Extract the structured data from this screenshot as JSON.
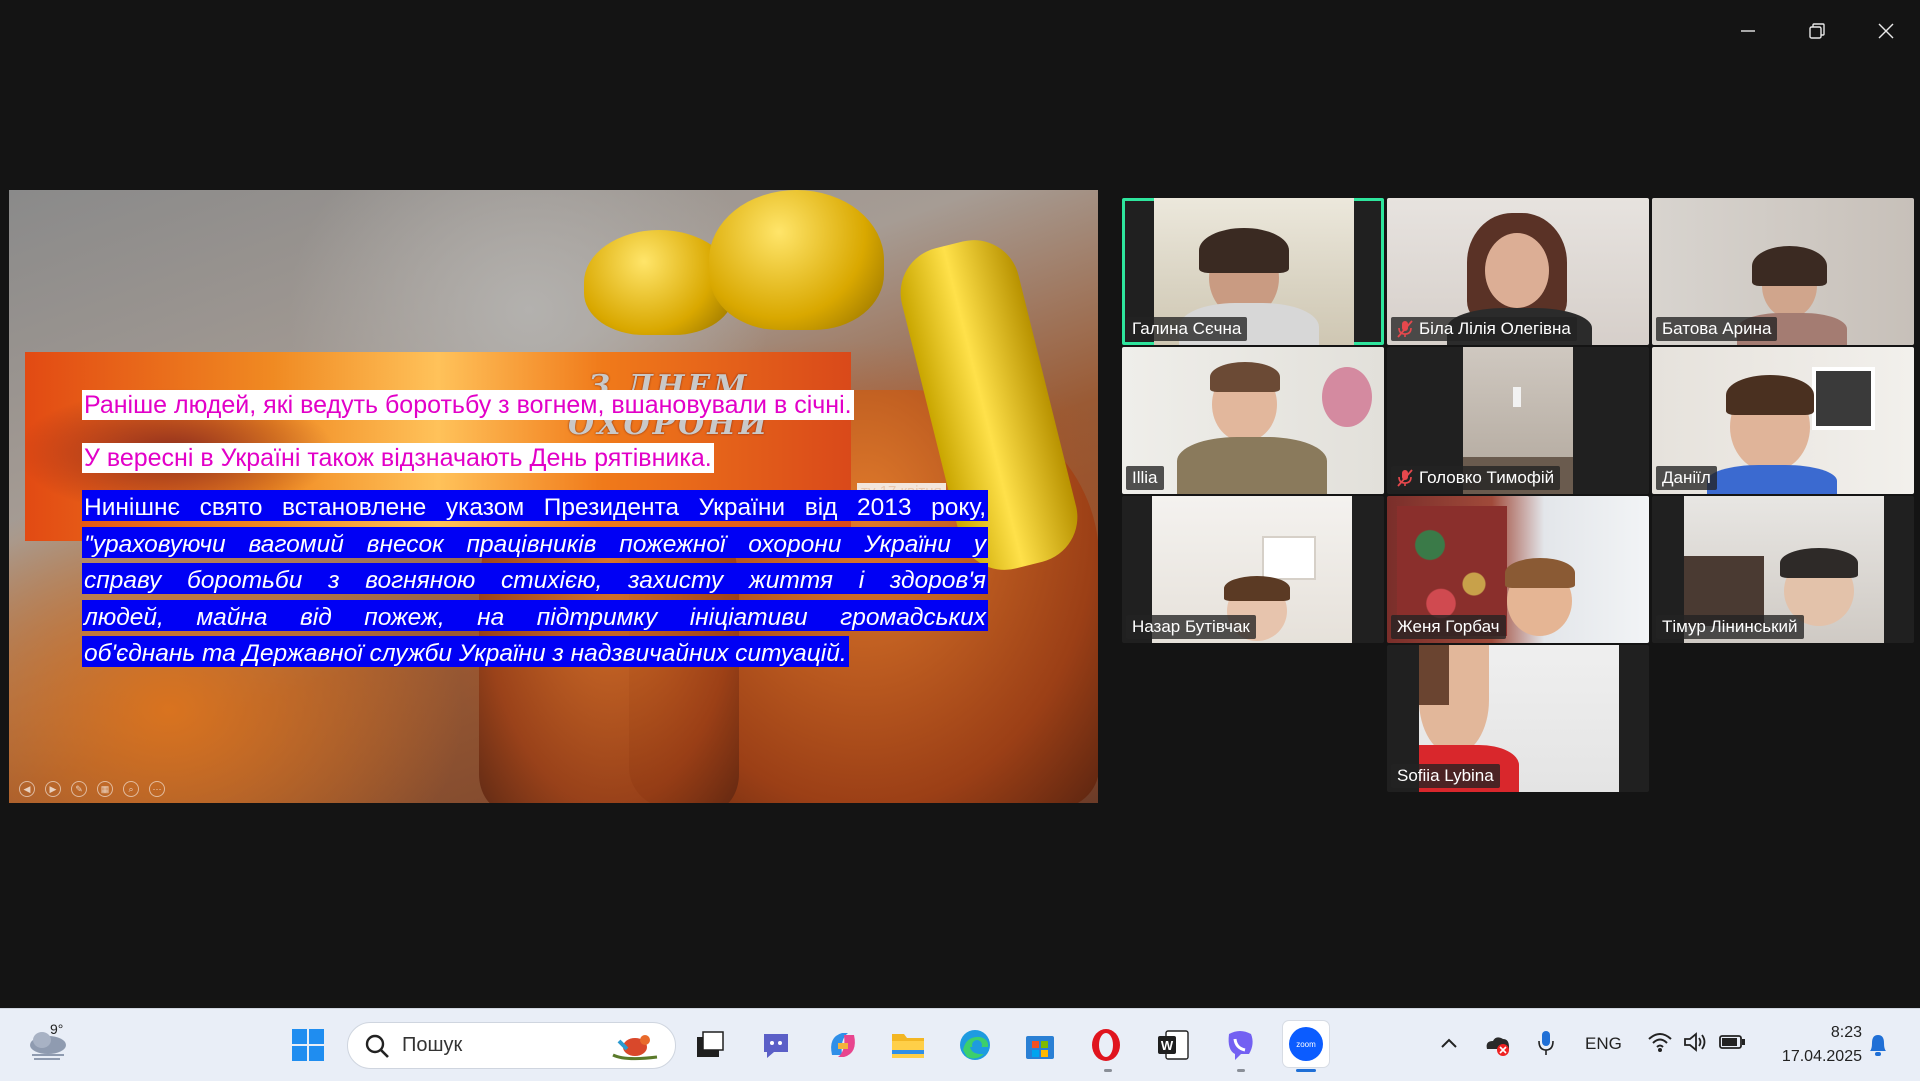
{
  "slide": {
    "band_title": "З ДНЕМ ОХОРОНИ",
    "date_snippet": "ту 17 квітня",
    "line1": "Раніше людей, які ведуть боротьбу з вогнем, вшановували в січні.",
    "line2": "У вересні в Україні також відзначають День рятівника.",
    "para": [
      "Нинішнє свято встановлене указом Президента України від 2013 року,",
      "\"ураховуючи вагомий внесок працівників пожежної охорони України у",
      "справу боротьби з вогняною стихією, захисту життя і здоров'я",
      "людей, майна від пожеж, на підтримку ініціативи громадських",
      "об'єднань та Державної служби України з надзвичайних ситуацій."
    ],
    "colors": {
      "magenta_text": "#e200c8",
      "blue_highlight": "#0000f5"
    }
  },
  "participants": [
    {
      "name": "Галина Сєчна",
      "muted": false,
      "active": true
    },
    {
      "name": "Біла Лілія Олегівна",
      "muted": true,
      "active": false
    },
    {
      "name": "Батова Арина",
      "muted": false,
      "active": false
    },
    {
      "name": "Illia",
      "muted": false,
      "active": false
    },
    {
      "name": "Головко Тимофій",
      "muted": true,
      "active": false
    },
    {
      "name": "Даніїл",
      "muted": false,
      "active": false
    },
    {
      "name": "Назар Бутівчак",
      "muted": false,
      "active": false
    },
    {
      "name": "Женя Горбач",
      "muted": false,
      "active": false
    },
    {
      "name": "Тімур Лінинський",
      "muted": false,
      "active": false
    },
    {
      "name": "Sofiia Lybina",
      "muted": false,
      "active": false
    }
  ],
  "taskbar": {
    "weather_temp": "9°",
    "search_placeholder": "Пошук",
    "apps": [
      "task-view",
      "teams-chat",
      "copilot",
      "file-explorer",
      "edge",
      "microsoft-store",
      "opera",
      "word",
      "viber",
      "zoom"
    ],
    "language": "ENG",
    "time": "8:23",
    "date": "17.04.2025"
  },
  "accent_color": "#2ee59d"
}
